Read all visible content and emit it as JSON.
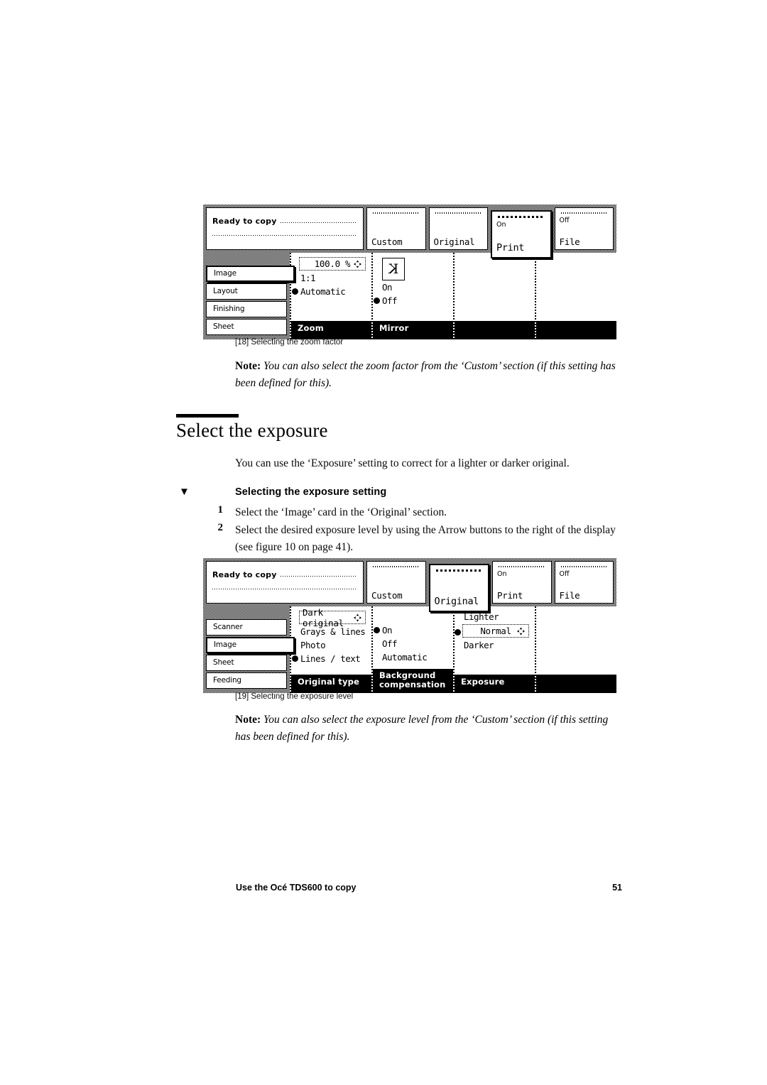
{
  "page": {
    "footer_left": "Use the Océ TDS600 to copy",
    "footer_page": "51"
  },
  "figure18": {
    "caption": "[18] Selecting the zoom factor",
    "status": {
      "title": "Ready to copy"
    },
    "tabs": [
      {
        "label": "Custom",
        "sub": "",
        "active": false
      },
      {
        "label": "Original",
        "sub": "",
        "active": false
      },
      {
        "label": "Print",
        "sub": "On",
        "active": true
      },
      {
        "label": "File",
        "sub": "Off",
        "active": false
      }
    ],
    "sidebar": [
      {
        "label": "Image",
        "active": true
      },
      {
        "label": "Layout",
        "active": false
      },
      {
        "label": "Finishing",
        "active": false
      },
      {
        "label": "Sheet",
        "active": false
      }
    ],
    "columns": [
      {
        "footer": "Zoom",
        "value_box": "100.0 %",
        "options": [
          {
            "label": "1:1",
            "selected": false
          },
          {
            "label": "Automatic",
            "selected": true
          }
        ]
      },
      {
        "footer": "Mirror",
        "icon": "mirrored-k-icon",
        "icon_glyph": "K",
        "options": [
          {
            "label": "On",
            "selected": false
          },
          {
            "label": "Off",
            "selected": true
          }
        ]
      },
      {
        "footer": "",
        "options": []
      },
      {
        "footer": "",
        "options": []
      }
    ]
  },
  "note18": {
    "label": "Note:",
    "text": "You can also select the zoom factor from the ‘Custom’ section (if this setting has been defined for this)."
  },
  "section": {
    "heading": "Select the exposure",
    "intro": "You can use the ‘Exposure’ setting to correct for a lighter or darker original.",
    "procedure_title": "Selecting the exposure setting",
    "marker": "▼",
    "steps": [
      {
        "num": "1",
        "text": "Select the ‘Image’ card in the ‘Original’ section."
      },
      {
        "num": "2",
        "text": "Select the desired exposure level by using the Arrow buttons to the right of the display (see figure 10 on page 41)."
      }
    ]
  },
  "figure19": {
    "caption": "[19] Selecting the exposure level",
    "status": {
      "title": "Ready to copy"
    },
    "tabs": [
      {
        "label": "Custom",
        "sub": "",
        "active": false
      },
      {
        "label": "Original",
        "sub": "",
        "active": true
      },
      {
        "label": "Print",
        "sub": "On",
        "active": false
      },
      {
        "label": "File",
        "sub": "Off",
        "active": false
      }
    ],
    "sidebar": [
      {
        "label": "Scanner",
        "active": false
      },
      {
        "label": "Image",
        "active": true
      },
      {
        "label": "Sheet",
        "active": false
      },
      {
        "label": "Feeding",
        "active": false
      }
    ],
    "columns": [
      {
        "footer": "Original type",
        "value_box": "Dark original",
        "options": [
          {
            "label": "Grays & lines",
            "selected": false
          },
          {
            "label": "Photo",
            "selected": false
          },
          {
            "label": "Lines / text",
            "selected": true
          }
        ]
      },
      {
        "footer": "Background compensation",
        "footer_line1": "Background",
        "footer_line2": "compensation",
        "options": [
          {
            "label": "On",
            "selected": true
          },
          {
            "label": "Off",
            "selected": false
          },
          {
            "label": "Automatic",
            "selected": false
          }
        ]
      },
      {
        "footer": "Exposure",
        "top_option": "Lighter",
        "value_box": "Normal",
        "value_selected": true,
        "bottom_option": "Darker"
      },
      {
        "footer": "",
        "options": []
      }
    ]
  },
  "note19": {
    "label": "Note:",
    "text": "You can also select the exposure level from the ‘Custom’ section (if this setting has been defined for this)."
  }
}
